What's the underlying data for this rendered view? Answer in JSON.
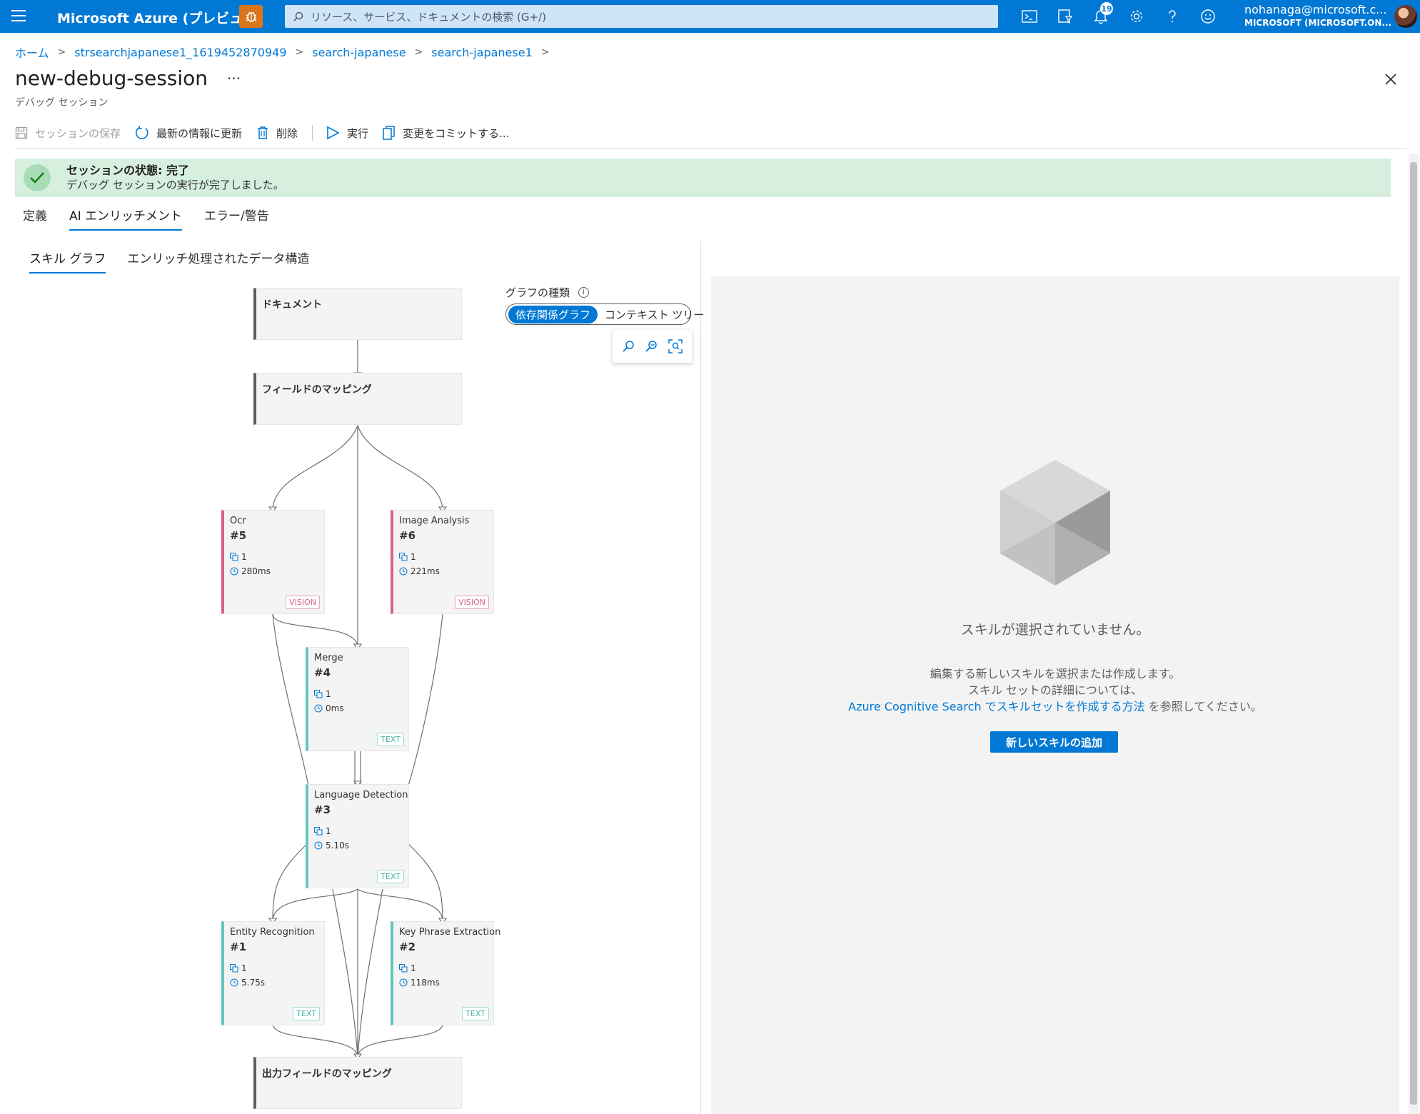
{
  "topbar": {
    "brand": "Microsoft Azure (プレビュー)",
    "search_placeholder": "リソース、サービス、ドキュメントの検索 (G+/)",
    "notification_count": "19",
    "user_email": "nohanaga@microsoft.c...",
    "user_tenant": "MICROSOFT (MICROSOFT.ON..."
  },
  "breadcrumb": [
    "ホーム",
    "strsearchjapanese1_1619452870949",
    "search-japanese",
    "search-japanese1"
  ],
  "page": {
    "title": "new-debug-session",
    "more": "···",
    "subtitle": "デバッグ セッション"
  },
  "toolbar": {
    "save": "セッションの保存",
    "refresh": "最新の情報に更新",
    "delete": "削除",
    "run": "実行",
    "commit": "変更をコミットする..."
  },
  "banner": {
    "title": "セッションの状態: 完了",
    "message": "デバッグ セッションの実行が完了しました。"
  },
  "tabs": [
    "定義",
    "AI エンリッチメント",
    "エラー/警告"
  ],
  "subtabs": [
    "スキル グラフ",
    "エンリッチ処理されたデータ構造"
  ],
  "graph_type": {
    "label": "グラフの種類",
    "info": "i",
    "options": [
      "依存関係グラフ",
      "コンテキスト ツリー"
    ]
  },
  "nodes": {
    "document": "ドキュメント",
    "field_mapping": "フィールドのマッピング",
    "output_mapping": "出力フィールドのマッピング",
    "skills": [
      {
        "name": "Ocr",
        "id": "#5",
        "count": "1",
        "time": "280ms",
        "tag": "VISION"
      },
      {
        "name": "Image Analysis",
        "id": "#6",
        "count": "1",
        "time": "221ms",
        "tag": "VISION"
      },
      {
        "name": "Merge",
        "id": "#4",
        "count": "1",
        "time": "0ms",
        "tag": "TEXT"
      },
      {
        "name": "Language Detection",
        "id": "#3",
        "count": "1",
        "time": "5.10s",
        "tag": "TEXT"
      },
      {
        "name": "Entity Recognition",
        "id": "#1",
        "count": "1",
        "time": "5.75s",
        "tag": "TEXT"
      },
      {
        "name": "Key Phrase Extraction",
        "id": "#2",
        "count": "1",
        "time": "118ms",
        "tag": "TEXT"
      }
    ]
  },
  "right_panel": {
    "title": "スキルが選択されていません。",
    "line1": "編集する新しいスキルを選択または作成します。",
    "line2": "スキル セットの詳細については、",
    "link": "Azure Cognitive Search でスキルセットを作成する方法",
    "line3_suffix": " を参照してください。",
    "button": "新しいスキルの追加"
  },
  "colors": {
    "accent": "#0078d4",
    "success_bg": "#d6efde",
    "vision": "#d8618a",
    "text": "#61c7b8"
  }
}
